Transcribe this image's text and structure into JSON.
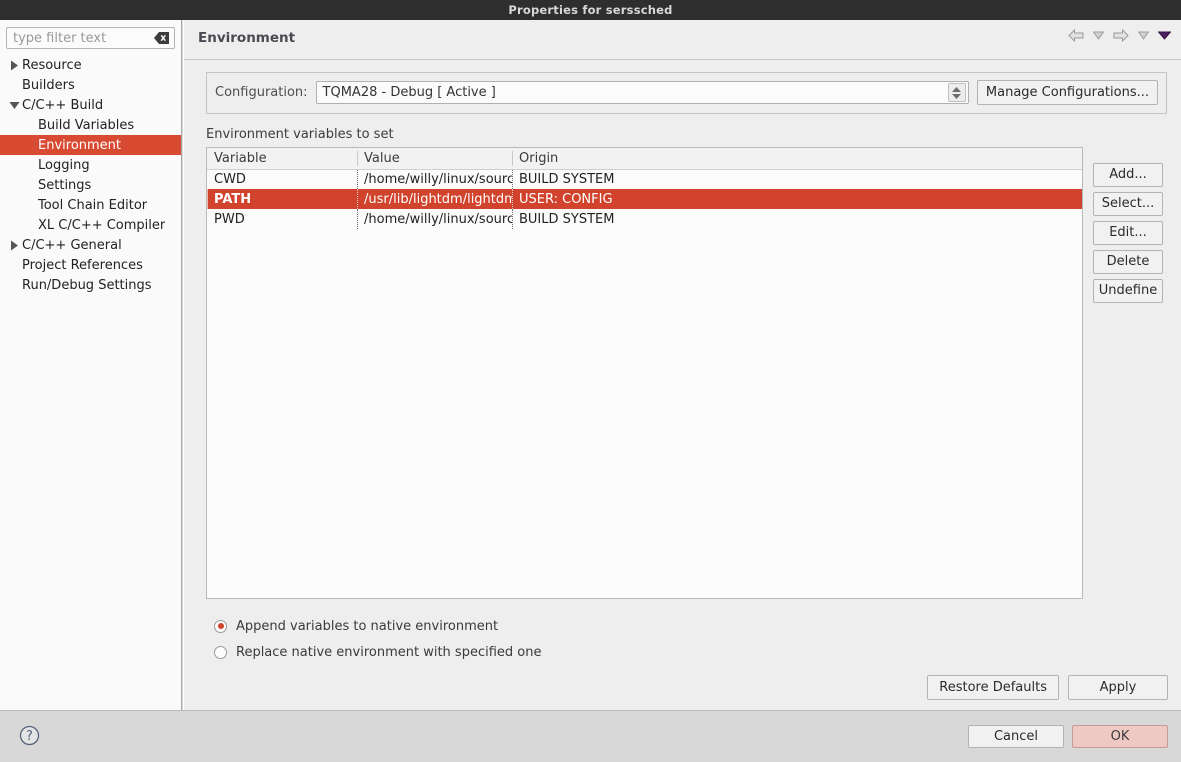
{
  "window": {
    "title": "Properties for serssched"
  },
  "sidebar": {
    "filter": {
      "placeholder": "type filter text",
      "value": "",
      "clear_icon": "clear-backspace-icon"
    },
    "items": [
      {
        "label": "Resource",
        "twisty": "collapsed",
        "indent": 1,
        "selected": false
      },
      {
        "label": "Builders",
        "twisty": "none",
        "indent": 1,
        "selected": false
      },
      {
        "label": "C/C++ Build",
        "twisty": "expanded",
        "indent": 1,
        "selected": false
      },
      {
        "label": "Build Variables",
        "twisty": "none",
        "indent": 2,
        "selected": false
      },
      {
        "label": "Environment",
        "twisty": "none",
        "indent": 2,
        "selected": true
      },
      {
        "label": "Logging",
        "twisty": "none",
        "indent": 2,
        "selected": false
      },
      {
        "label": "Settings",
        "twisty": "none",
        "indent": 2,
        "selected": false
      },
      {
        "label": "Tool Chain Editor",
        "twisty": "none",
        "indent": 2,
        "selected": false
      },
      {
        "label": "XL C/C++ Compiler",
        "twisty": "none",
        "indent": 2,
        "selected": false
      },
      {
        "label": "C/C++ General",
        "twisty": "collapsed",
        "indent": 1,
        "selected": false
      },
      {
        "label": "Project References",
        "twisty": "none",
        "indent": 1,
        "selected": false
      },
      {
        "label": "Run/Debug Settings",
        "twisty": "none",
        "indent": 1,
        "selected": false
      }
    ]
  },
  "header": {
    "title": "Environment",
    "nav": {
      "back_icon": "back-arrow-icon",
      "back_menu_icon": "chevron-down-icon",
      "forward_icon": "forward-arrow-icon",
      "forward_menu_icon": "chevron-down-icon",
      "view_menu_icon": "view-menu-triangle-icon"
    }
  },
  "configuration": {
    "label": "Configuration:",
    "value": "TQMA28 - Debug  [ Active ]",
    "manage_button": "Manage Configurations..."
  },
  "table": {
    "caption": "Environment variables to set",
    "columns": [
      "Variable",
      "Value",
      "Origin"
    ],
    "rows": [
      {
        "variable": "CWD",
        "value": "/home/willy/linux/source",
        "origin": "BUILD SYSTEM",
        "selected": false
      },
      {
        "variable": "PATH",
        "value": "/usr/lib/lightdm/lightdm",
        "origin": "USER: CONFIG",
        "selected": true
      },
      {
        "variable": "PWD",
        "value": "/home/willy/linux/source",
        "origin": "BUILD SYSTEM",
        "selected": false
      }
    ]
  },
  "side_buttons": [
    {
      "label": "Add...",
      "name": "add-button"
    },
    {
      "label": "Select...",
      "name": "select-button"
    },
    {
      "label": "Edit...",
      "name": "edit-button"
    },
    {
      "label": "Delete",
      "name": "delete-button"
    },
    {
      "label": "Undefine",
      "name": "undefine-button"
    }
  ],
  "radios": [
    {
      "label": "Append variables to native environment",
      "selected": true
    },
    {
      "label": "Replace native environment with specified one",
      "selected": false
    }
  ],
  "apply_row": {
    "restore_defaults": "Restore Defaults",
    "apply": "Apply"
  },
  "footer": {
    "help_icon": "help-question-icon",
    "cancel": "Cancel",
    "ok": "OK"
  },
  "colors": {
    "selection_red": "#d1432c",
    "sidebar_selection": "#d94a33",
    "ok_button": "#eec9c4",
    "titlebar": "#2e2e2e"
  }
}
